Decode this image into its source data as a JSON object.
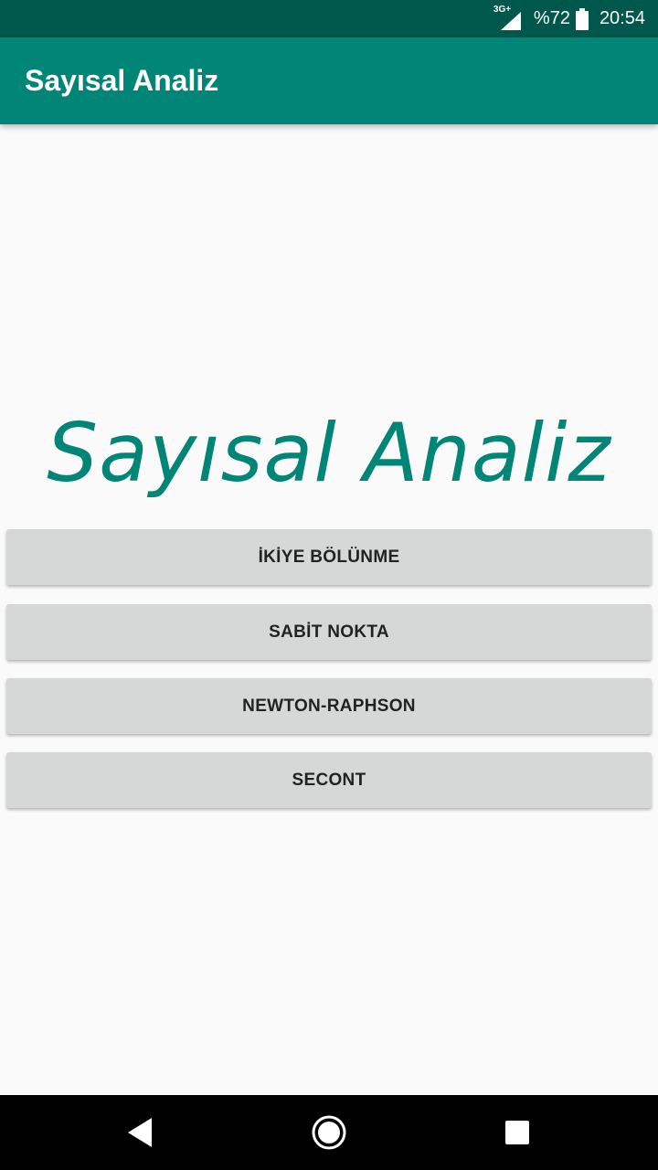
{
  "status_bar": {
    "network_type": "3G+",
    "battery_percent": "%72",
    "time": "20:54",
    "icons": [
      "signal-icon",
      "battery-icon"
    ]
  },
  "app_bar": {
    "title": "Sayısal Analiz"
  },
  "main": {
    "logo_title": "Sayısal Analiz",
    "buttons": [
      {
        "label": "İKİYE BÖLÜNME"
      },
      {
        "label": "SABİT NOKTA"
      },
      {
        "label": "NEWTON-RAPHSON"
      },
      {
        "label": "SECONT"
      }
    ]
  },
  "nav_bar": {
    "icons": [
      "back-icon",
      "home-icon",
      "recents-icon"
    ]
  },
  "colors": {
    "primary": "#008577",
    "primary_dark": "#00574b",
    "background": "#fafafa",
    "button_bg": "#d6d7d7",
    "button_text": "#222222"
  }
}
